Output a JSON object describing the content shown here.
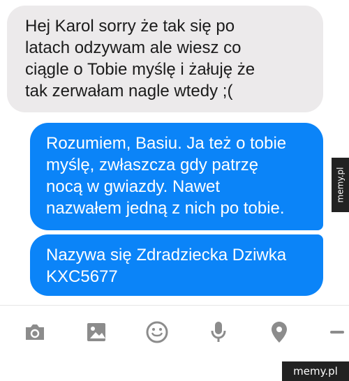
{
  "conversation": {
    "incoming_message": "Hej Karol sorry że tak się po\nlatach odzywam ale wiesz co\nciągle o Tobie myślę i żałuję że\ntak zerwałam nagle wtedy ;(",
    "outgoing_messages": [
      "Rozumiem, Basiu. Ja też o tobie\nmyślę, zwłaszcza gdy patrzę\nnocą w gwiazdy. Nawet\nnazwałem jedną z nich po tobie.",
      "Nazywa się Zdradziecka Dziwka\nKXC5677"
    ]
  },
  "toolbar": {
    "icons": [
      "camera-icon",
      "image-icon",
      "emoji-icon",
      "microphone-icon",
      "location-icon"
    ]
  },
  "watermark": {
    "side_text": "memy.pl",
    "bottom_text": "memy.pl"
  },
  "colors": {
    "incoming_bubble": "#eceaeb",
    "outgoing_bubble": "#0b84f8",
    "icon_gray": "#8c8c8c"
  }
}
